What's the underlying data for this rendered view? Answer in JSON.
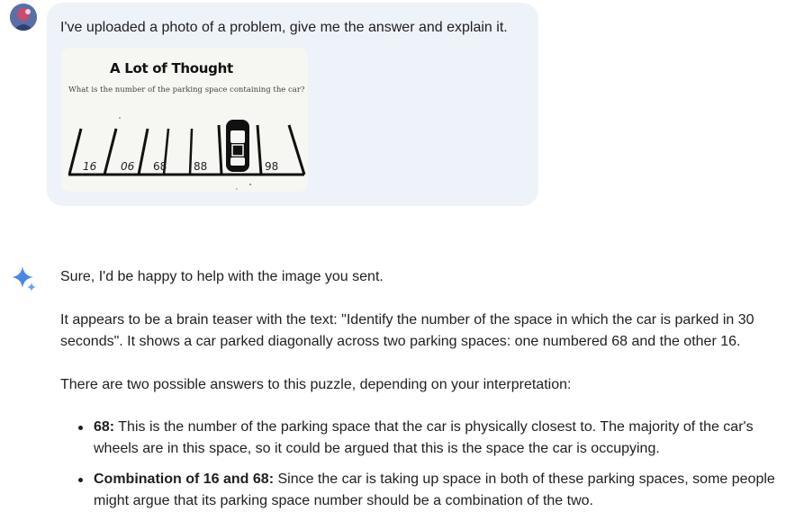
{
  "prompt": {
    "text": "I've uploaded a photo of a problem, give me the answer and explain it."
  },
  "photo": {
    "title": "A Lot of Thought",
    "question": "What is the number of the parking space containing the car?",
    "space_numbers": [
      "16",
      "06",
      "68",
      "88",
      "98"
    ]
  },
  "response": {
    "intro": "Sure, I'd be happy to help with the image you sent.",
    "description": "It appears to be a brain teaser with the text: \"Identify the number of the space in which the car is parked in 30 seconds\". It shows a car parked diagonally across two parking spaces: one numbered 68 and the other 16.",
    "answers_intro": "There are two possible answers to this puzzle, depending on your interpretation:",
    "bullets": [
      {
        "label": "68:",
        "text": " This is the number of the parking space that the car is physically closest to. The majority of the car's wheels are in this space, so it could be argued that this is the space the car is occupying."
      },
      {
        "label": "Combination of 16 and 68:",
        "text": " Since the car is taking up space in both of these parking spaces, some people might argue that its parking space number should be a combination of the two."
      }
    ]
  },
  "icons": {
    "avatar": "user-avatar",
    "assistant": "sparkle-icon"
  },
  "colors": {
    "bubble": "#eef2f9",
    "sparkle_blue": "#4a88e8",
    "text": "#1f1f1f"
  }
}
